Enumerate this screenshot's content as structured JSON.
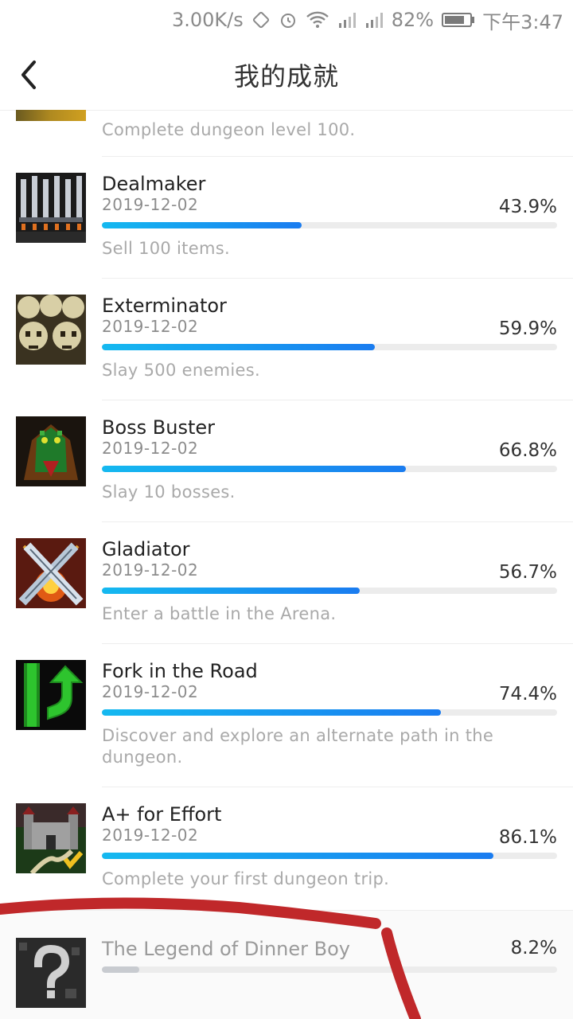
{
  "status_bar": {
    "speed": "3.00K/s",
    "battery": "82%",
    "time": "下午3:47"
  },
  "header": {
    "title": "我的成就"
  },
  "top_fragment": {
    "description": "Complete dungeon level 100."
  },
  "achievements": [
    {
      "name": "Dealmaker",
      "date": "2019-12-02",
      "percent": "43.9%",
      "progress": 0.439,
      "description": "Sell 100 items.",
      "icon": "swords-rack-icon"
    },
    {
      "name": "Exterminator",
      "date": "2019-12-02",
      "percent": "59.9%",
      "progress": 0.599,
      "description": "Slay 500 enemies.",
      "icon": "skulls-icon"
    },
    {
      "name": "Boss Buster",
      "date": "2019-12-02",
      "percent": "66.8%",
      "progress": 0.668,
      "description": "Slay 10 bosses.",
      "icon": "dragon-icon"
    },
    {
      "name": "Gladiator",
      "date": "2019-12-02",
      "percent": "56.7%",
      "progress": 0.567,
      "description": "Enter a battle in the Arena.",
      "icon": "crossed-swords-icon"
    },
    {
      "name": "Fork in the Road",
      "date": "2019-12-02",
      "percent": "74.4%",
      "progress": 0.744,
      "description": "Discover and explore an alternate path in the dungeon.",
      "icon": "fork-arrow-icon"
    },
    {
      "name": "A+ for Effort",
      "date": "2019-12-02",
      "percent": "86.1%",
      "progress": 0.861,
      "description": "Complete your first dungeon trip.",
      "icon": "castle-icon"
    }
  ],
  "locked_achievement": {
    "name": "The Legend of Dinner Boy",
    "percent": "8.2%",
    "progress": 0.082,
    "icon": "question-mark-icon"
  },
  "colors": {
    "progress_fill_start": "#15b9f0",
    "progress_fill_end": "#1a7cf0",
    "locked_fill": "#c8cbd0",
    "annotation": "#c0282a"
  }
}
